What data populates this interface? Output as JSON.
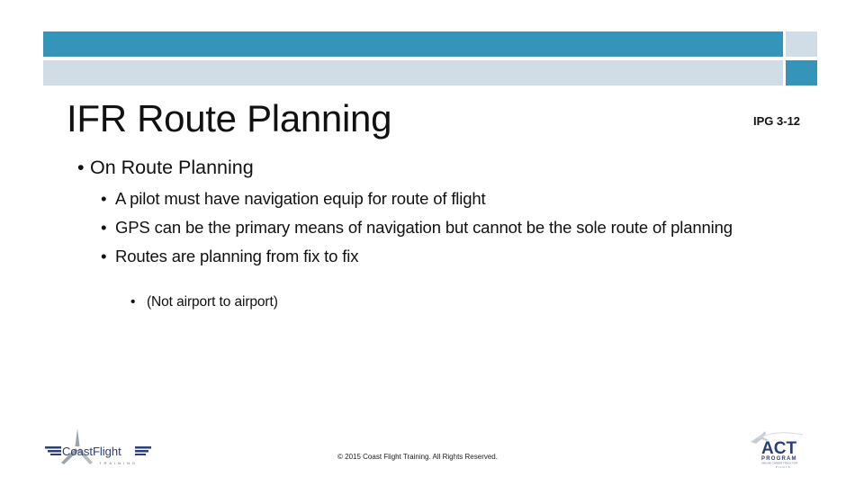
{
  "slide": {
    "title": "IFR Route Planning",
    "reference": "IPG 3-12",
    "bullet_glyph": "•",
    "content": {
      "level1": "On Route Planning",
      "level2": [
        "A pilot must have navigation equip for route of flight",
        "GPS can be the primary means of navigation but cannot be the sole route of planning",
        "Routes are planning from fix to fix"
      ],
      "level3": "(Not airport to airport)"
    },
    "footer": "© 2015 Coast Flight Training. All Rights Reserved.",
    "logos": {
      "left": {
        "name": "CoastFlight",
        "wordmark": "CoastFlight",
        "subtitle": "TRAINING"
      },
      "right": {
        "name": "ACT Program",
        "wordmark": "ACT",
        "subtitle": "PROGRAM",
        "tagline_1": "AIRLINE CAREER TRACK FOR",
        "tagline_2": "PILOTS"
      }
    }
  },
  "colors": {
    "accent_blue": "#3494ba",
    "light_gray_blue": "#d0dde6",
    "logo_navy": "#2c3e7a",
    "logo_gray": "#9aa4ad"
  }
}
